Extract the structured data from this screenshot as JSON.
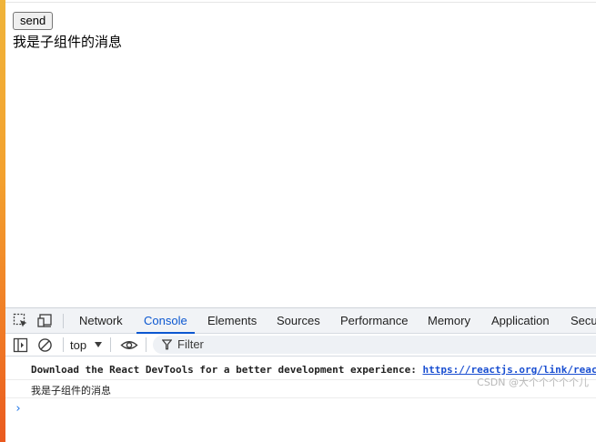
{
  "page": {
    "send_button_label": "send",
    "child_message": "我是子组件的消息"
  },
  "devtools": {
    "tabs": [
      {
        "label": "Network",
        "active": false
      },
      {
        "label": "Console",
        "active": true
      },
      {
        "label": "Elements",
        "active": false
      },
      {
        "label": "Sources",
        "active": false
      },
      {
        "label": "Performance",
        "active": false
      },
      {
        "label": "Memory",
        "active": false
      },
      {
        "label": "Application",
        "active": false
      },
      {
        "label": "Secu",
        "active": false
      }
    ],
    "icons": {
      "inspect": "inspect-element-icon",
      "device": "device-toolbar-icon",
      "sidebar": "sidebar-toggle-icon",
      "clear": "clear-console-icon",
      "eye": "live-expression-eye-icon",
      "filter": "filter-funnel-icon"
    },
    "console": {
      "context": "top",
      "filter_placeholder": "Filter",
      "log1_text": "Download the React DevTools for a better development experience: ",
      "log1_link": "https://reactjs.org/link/react-devtools",
      "log2_text": "我是子组件的消息",
      "prompt": "›"
    },
    "colors": {
      "accent": "#0b57d0",
      "link": "#1a4fd1"
    }
  },
  "watermark": "CSDN @大个个个个个儿"
}
